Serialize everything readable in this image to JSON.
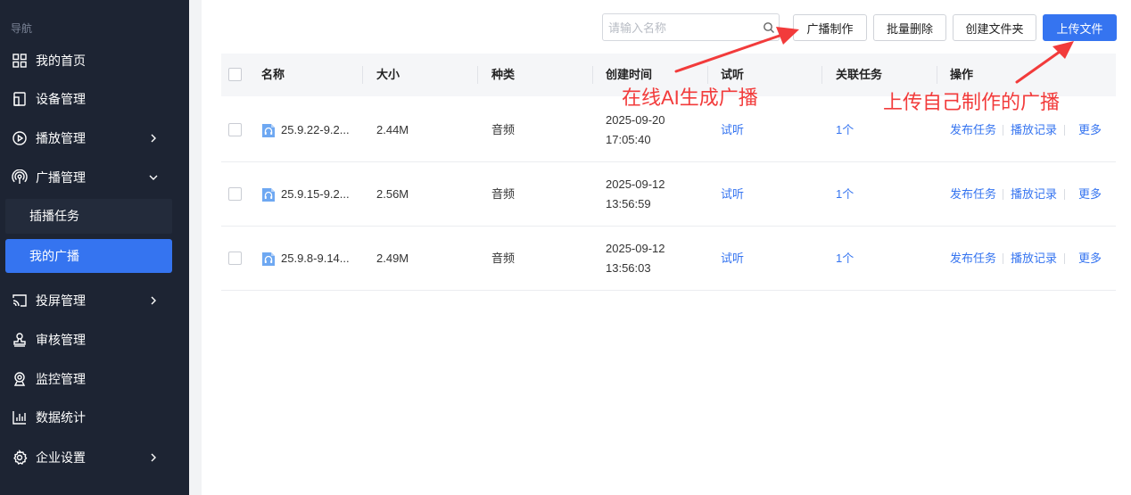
{
  "sidebar": {
    "title": "导航",
    "items": [
      {
        "label": "我的首页",
        "icon": "grid-icon"
      },
      {
        "label": "设备管理",
        "icon": "device-icon"
      },
      {
        "label": "播放管理",
        "icon": "play-circle-icon",
        "chevron": "right"
      },
      {
        "label": "广播管理",
        "icon": "broadcast-icon",
        "chevron": "down",
        "expanded": true
      },
      {
        "label": "投屏管理",
        "icon": "cast-icon",
        "chevron": "right"
      },
      {
        "label": "审核管理",
        "icon": "stamp-icon"
      },
      {
        "label": "监控管理",
        "icon": "webcam-icon"
      },
      {
        "label": "数据统计",
        "icon": "bar-chart-icon"
      },
      {
        "label": "企业设置",
        "icon": "gear-icon",
        "chevron": "right"
      }
    ],
    "sub_items": [
      {
        "label": "插播任务",
        "active": false
      },
      {
        "label": "我的广播",
        "active": true
      }
    ]
  },
  "toolbar": {
    "search_placeholder": "请输入名称",
    "buttons": {
      "produce": "广播制作",
      "batch_delete": "批量删除",
      "create_folder": "创建文件夹",
      "upload": "上传文件"
    }
  },
  "table": {
    "headers": {
      "name": "名称",
      "size": "大小",
      "type": "种类",
      "created": "创建时间",
      "preview": "试听",
      "tasks": "关联任务",
      "actions": "操作"
    },
    "rows": [
      {
        "name": "25.9.22-9.2...",
        "size": "2.44M",
        "type": "音频",
        "date": "2025-09-20",
        "time": "17:05:40",
        "preview": "试听",
        "tasks": "1个",
        "publish": "发布任务",
        "records": "播放记录",
        "more": "更多"
      },
      {
        "name": "25.9.15-9.2...",
        "size": "2.56M",
        "type": "音频",
        "date": "2025-09-12",
        "time": "13:56:59",
        "preview": "试听",
        "tasks": "1个",
        "publish": "发布任务",
        "records": "播放记录",
        "more": "更多"
      },
      {
        "name": "25.9.8-9.14...",
        "size": "2.49M",
        "type": "音频",
        "date": "2025-09-12",
        "time": "13:56:03",
        "preview": "试听",
        "tasks": "1个",
        "publish": "发布任务",
        "records": "播放记录",
        "more": "更多"
      }
    ]
  },
  "annotations": {
    "ai": "在线AI生成广播",
    "upload": "上传自己制作的广播",
    "color": "#f23b3b"
  },
  "colors": {
    "sidebar_bg": "#1d2433",
    "accent": "#3574f0",
    "link": "#3574f0"
  }
}
